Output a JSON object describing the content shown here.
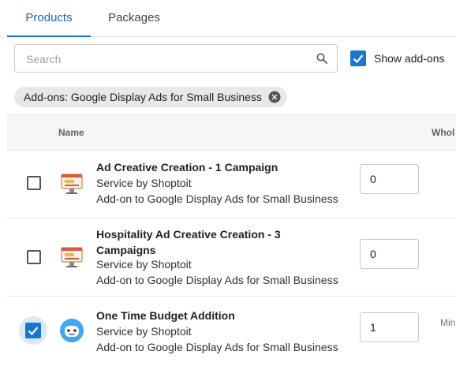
{
  "tabs": {
    "products": "Products",
    "packages": "Packages"
  },
  "search": {
    "placeholder": "Search",
    "value": ""
  },
  "show_addons": {
    "label": "Show add-ons",
    "checked": true
  },
  "filter_chip": {
    "label": "Add-ons: Google Display Ads for Small Business"
  },
  "table": {
    "columns": {
      "name": "Name",
      "wholesale": "Whol"
    },
    "rows": [
      {
        "checked": false,
        "icon": "ad-creative-icon",
        "name": "Ad Creative Creation - 1 Campaign",
        "service": "Service by Shoptoit",
        "addon_of": "Add-on to Google Display Ads for Small Business",
        "quantity": "0",
        "extra": ""
      },
      {
        "checked": false,
        "icon": "ad-creative-icon",
        "name": "Hospitality Ad Creative Creation - 3 Campaigns",
        "service": "Service by Shoptoit",
        "addon_of": "Add-on to Google Display Ads for Small Business",
        "quantity": "0",
        "extra": ""
      },
      {
        "checked": true,
        "icon": "robot-face-icon",
        "name": "One Time Budget Addition",
        "service": "Service by Shoptoit",
        "addon_of": "Add-on to Google Display Ads for Small Business",
        "quantity": "1",
        "extra": "Min"
      }
    ]
  },
  "colors": {
    "accent": "#1976d2",
    "header_bg": "#f6f6f6",
    "chip_bg": "#e8e8e8"
  }
}
